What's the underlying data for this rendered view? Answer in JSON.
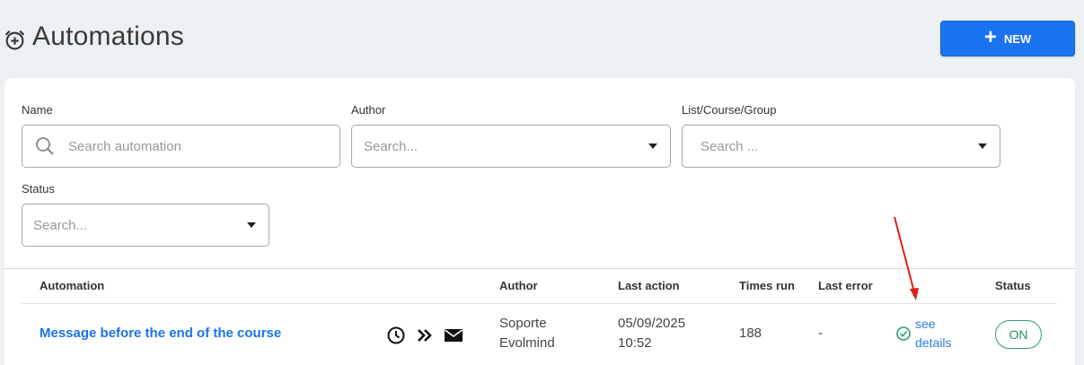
{
  "header": {
    "title": "Automations",
    "new_button_label": "NEW",
    "accent_color": "#1a73f0"
  },
  "filters": {
    "name": {
      "label": "Name",
      "placeholder": "Search automation"
    },
    "author": {
      "label": "Author",
      "placeholder": "Search..."
    },
    "list_course_group": {
      "label": "List/Course/Group",
      "placeholder": "Search ..."
    },
    "status": {
      "label": "Status",
      "placeholder": "Search..."
    }
  },
  "table": {
    "columns": [
      "Automation",
      "Author",
      "Last action",
      "Times run",
      "Last error",
      "Status"
    ],
    "rows": [
      {
        "automation": "Message before the end of the course",
        "icons": [
          "clock-icon",
          "double-chevron-right-icon",
          "envelope-icon"
        ],
        "author_line1": "Soporte",
        "author_line2": "Evolmind",
        "last_action_date": "05/09/2025",
        "last_action_time": "10:52",
        "times_run": "188",
        "last_error": "-",
        "see_details_line1": "see",
        "see_details_line2": "details",
        "status": "ON"
      }
    ]
  },
  "annotation": {
    "type": "arrow",
    "color": "#e21c1c",
    "points_to": "see details"
  }
}
